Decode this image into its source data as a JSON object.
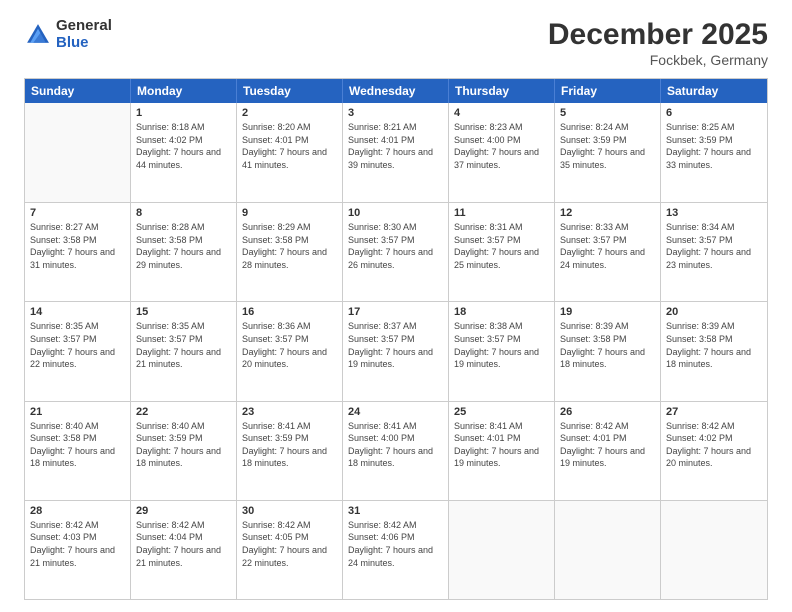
{
  "logo": {
    "general": "General",
    "blue": "Blue"
  },
  "header": {
    "month": "December 2025",
    "location": "Fockbek, Germany"
  },
  "weekdays": [
    "Sunday",
    "Monday",
    "Tuesday",
    "Wednesday",
    "Thursday",
    "Friday",
    "Saturday"
  ],
  "rows": [
    [
      {
        "day": "",
        "empty": true
      },
      {
        "day": "1",
        "sunrise": "Sunrise: 8:18 AM",
        "sunset": "Sunset: 4:02 PM",
        "daylight": "Daylight: 7 hours and 44 minutes."
      },
      {
        "day": "2",
        "sunrise": "Sunrise: 8:20 AM",
        "sunset": "Sunset: 4:01 PM",
        "daylight": "Daylight: 7 hours and 41 minutes."
      },
      {
        "day": "3",
        "sunrise": "Sunrise: 8:21 AM",
        "sunset": "Sunset: 4:01 PM",
        "daylight": "Daylight: 7 hours and 39 minutes."
      },
      {
        "day": "4",
        "sunrise": "Sunrise: 8:23 AM",
        "sunset": "Sunset: 4:00 PM",
        "daylight": "Daylight: 7 hours and 37 minutes."
      },
      {
        "day": "5",
        "sunrise": "Sunrise: 8:24 AM",
        "sunset": "Sunset: 3:59 PM",
        "daylight": "Daylight: 7 hours and 35 minutes."
      },
      {
        "day": "6",
        "sunrise": "Sunrise: 8:25 AM",
        "sunset": "Sunset: 3:59 PM",
        "daylight": "Daylight: 7 hours and 33 minutes."
      }
    ],
    [
      {
        "day": "7",
        "sunrise": "Sunrise: 8:27 AM",
        "sunset": "Sunset: 3:58 PM",
        "daylight": "Daylight: 7 hours and 31 minutes."
      },
      {
        "day": "8",
        "sunrise": "Sunrise: 8:28 AM",
        "sunset": "Sunset: 3:58 PM",
        "daylight": "Daylight: 7 hours and 29 minutes."
      },
      {
        "day": "9",
        "sunrise": "Sunrise: 8:29 AM",
        "sunset": "Sunset: 3:58 PM",
        "daylight": "Daylight: 7 hours and 28 minutes."
      },
      {
        "day": "10",
        "sunrise": "Sunrise: 8:30 AM",
        "sunset": "Sunset: 3:57 PM",
        "daylight": "Daylight: 7 hours and 26 minutes."
      },
      {
        "day": "11",
        "sunrise": "Sunrise: 8:31 AM",
        "sunset": "Sunset: 3:57 PM",
        "daylight": "Daylight: 7 hours and 25 minutes."
      },
      {
        "day": "12",
        "sunrise": "Sunrise: 8:33 AM",
        "sunset": "Sunset: 3:57 PM",
        "daylight": "Daylight: 7 hours and 24 minutes."
      },
      {
        "day": "13",
        "sunrise": "Sunrise: 8:34 AM",
        "sunset": "Sunset: 3:57 PM",
        "daylight": "Daylight: 7 hours and 23 minutes."
      }
    ],
    [
      {
        "day": "14",
        "sunrise": "Sunrise: 8:35 AM",
        "sunset": "Sunset: 3:57 PM",
        "daylight": "Daylight: 7 hours and 22 minutes."
      },
      {
        "day": "15",
        "sunrise": "Sunrise: 8:35 AM",
        "sunset": "Sunset: 3:57 PM",
        "daylight": "Daylight: 7 hours and 21 minutes."
      },
      {
        "day": "16",
        "sunrise": "Sunrise: 8:36 AM",
        "sunset": "Sunset: 3:57 PM",
        "daylight": "Daylight: 7 hours and 20 minutes."
      },
      {
        "day": "17",
        "sunrise": "Sunrise: 8:37 AM",
        "sunset": "Sunset: 3:57 PM",
        "daylight": "Daylight: 7 hours and 19 minutes."
      },
      {
        "day": "18",
        "sunrise": "Sunrise: 8:38 AM",
        "sunset": "Sunset: 3:57 PM",
        "daylight": "Daylight: 7 hours and 19 minutes."
      },
      {
        "day": "19",
        "sunrise": "Sunrise: 8:39 AM",
        "sunset": "Sunset: 3:58 PM",
        "daylight": "Daylight: 7 hours and 18 minutes."
      },
      {
        "day": "20",
        "sunrise": "Sunrise: 8:39 AM",
        "sunset": "Sunset: 3:58 PM",
        "daylight": "Daylight: 7 hours and 18 minutes."
      }
    ],
    [
      {
        "day": "21",
        "sunrise": "Sunrise: 8:40 AM",
        "sunset": "Sunset: 3:58 PM",
        "daylight": "Daylight: 7 hours and 18 minutes."
      },
      {
        "day": "22",
        "sunrise": "Sunrise: 8:40 AM",
        "sunset": "Sunset: 3:59 PM",
        "daylight": "Daylight: 7 hours and 18 minutes."
      },
      {
        "day": "23",
        "sunrise": "Sunrise: 8:41 AM",
        "sunset": "Sunset: 3:59 PM",
        "daylight": "Daylight: 7 hours and 18 minutes."
      },
      {
        "day": "24",
        "sunrise": "Sunrise: 8:41 AM",
        "sunset": "Sunset: 4:00 PM",
        "daylight": "Daylight: 7 hours and 18 minutes."
      },
      {
        "day": "25",
        "sunrise": "Sunrise: 8:41 AM",
        "sunset": "Sunset: 4:01 PM",
        "daylight": "Daylight: 7 hours and 19 minutes."
      },
      {
        "day": "26",
        "sunrise": "Sunrise: 8:42 AM",
        "sunset": "Sunset: 4:01 PM",
        "daylight": "Daylight: 7 hours and 19 minutes."
      },
      {
        "day": "27",
        "sunrise": "Sunrise: 8:42 AM",
        "sunset": "Sunset: 4:02 PM",
        "daylight": "Daylight: 7 hours and 20 minutes."
      }
    ],
    [
      {
        "day": "28",
        "sunrise": "Sunrise: 8:42 AM",
        "sunset": "Sunset: 4:03 PM",
        "daylight": "Daylight: 7 hours and 21 minutes."
      },
      {
        "day": "29",
        "sunrise": "Sunrise: 8:42 AM",
        "sunset": "Sunset: 4:04 PM",
        "daylight": "Daylight: 7 hours and 21 minutes."
      },
      {
        "day": "30",
        "sunrise": "Sunrise: 8:42 AM",
        "sunset": "Sunset: 4:05 PM",
        "daylight": "Daylight: 7 hours and 22 minutes."
      },
      {
        "day": "31",
        "sunrise": "Sunrise: 8:42 AM",
        "sunset": "Sunset: 4:06 PM",
        "daylight": "Daylight: 7 hours and 24 minutes."
      },
      {
        "day": "",
        "empty": true
      },
      {
        "day": "",
        "empty": true
      },
      {
        "day": "",
        "empty": true
      }
    ]
  ]
}
